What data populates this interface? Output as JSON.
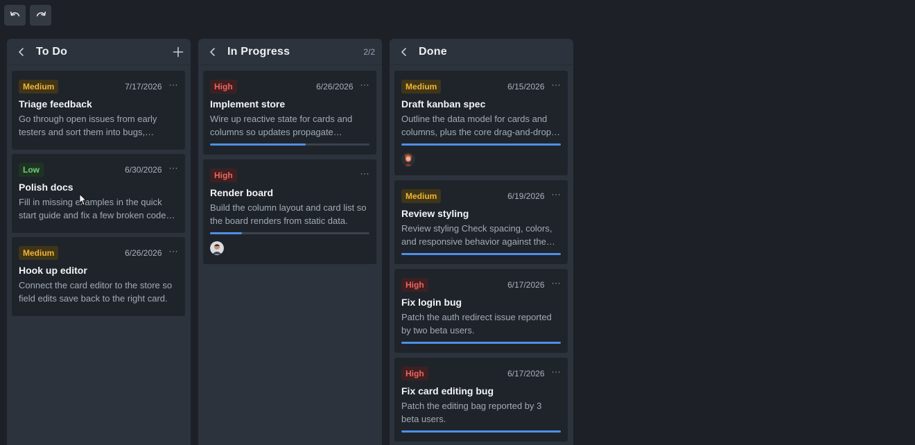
{
  "toolbar": {
    "undo_icon": "undo-icon",
    "redo_icon": "redo-icon"
  },
  "columns": [
    {
      "title": "To Do",
      "count": "",
      "cards": [
        {
          "priority": "Medium",
          "level": "medium",
          "date": "7/17/2026",
          "more": "···",
          "title": "Triage feedback",
          "desc": "Go through open issues from early testers and sort them into bugs, polish…"
        },
        {
          "priority": "Low",
          "level": "low",
          "date": "6/30/2026",
          "more": "···",
          "title": "Polish docs",
          "desc": "Fill in missing examples in the quick start guide and fix a few broken code…"
        },
        {
          "priority": "Medium",
          "level": "medium",
          "date": "6/26/2026",
          "more": "···",
          "title": "Hook up editor",
          "desc": "Connect the card editor to the store so field edits save back to the right card."
        }
      ]
    },
    {
      "title": "In Progress",
      "count": "2/2",
      "cards": [
        {
          "priority": "High",
          "level": "high",
          "date": "6/26/2026",
          "more": "···",
          "title": "Implement store",
          "desc": "Wire up reactive state for cards and columns so updates propagate throug…",
          "progress": 0.6
        },
        {
          "priority": "High",
          "level": "high",
          "date": "",
          "more": "···",
          "title": "Render board",
          "desc": "Build the column layout and card list so the board renders from static data.",
          "progress": 0.2,
          "avatar": "avatar-man"
        }
      ]
    },
    {
      "title": "Done",
      "count": "",
      "cards": [
        {
          "priority": "Medium",
          "level": "medium",
          "date": "6/15/2026",
          "more": "···",
          "title": "Draft kanban spec",
          "desc": "Outline the data model for cards and columns, plus the core drag-and-drop…",
          "progress": 1.0,
          "avatar": "avatar-woman"
        },
        {
          "priority": "Medium",
          "level": "medium",
          "date": "6/19/2026",
          "more": "···",
          "title": "Review styling",
          "desc": "Review styling Check spacing, colors, and responsive behavior against the…",
          "progress": 1.0
        },
        {
          "priority": "High",
          "level": "high",
          "date": "6/17/2026",
          "more": "···",
          "title": "Fix login bug",
          "desc": "Patch the auth redirect issue reported by two beta users.",
          "progress": 1.0
        },
        {
          "priority": "High",
          "level": "high",
          "date": "6/17/2026",
          "more": "···",
          "title": "Fix card editing bug",
          "desc": "Patch the editing bag reported by 3 beta users.",
          "progress": 1.0
        }
      ]
    }
  ],
  "colors": {
    "accent": "#4f8fe8",
    "medium": "#f2b437",
    "high": "#f0635f",
    "low": "#6fcf77"
  }
}
